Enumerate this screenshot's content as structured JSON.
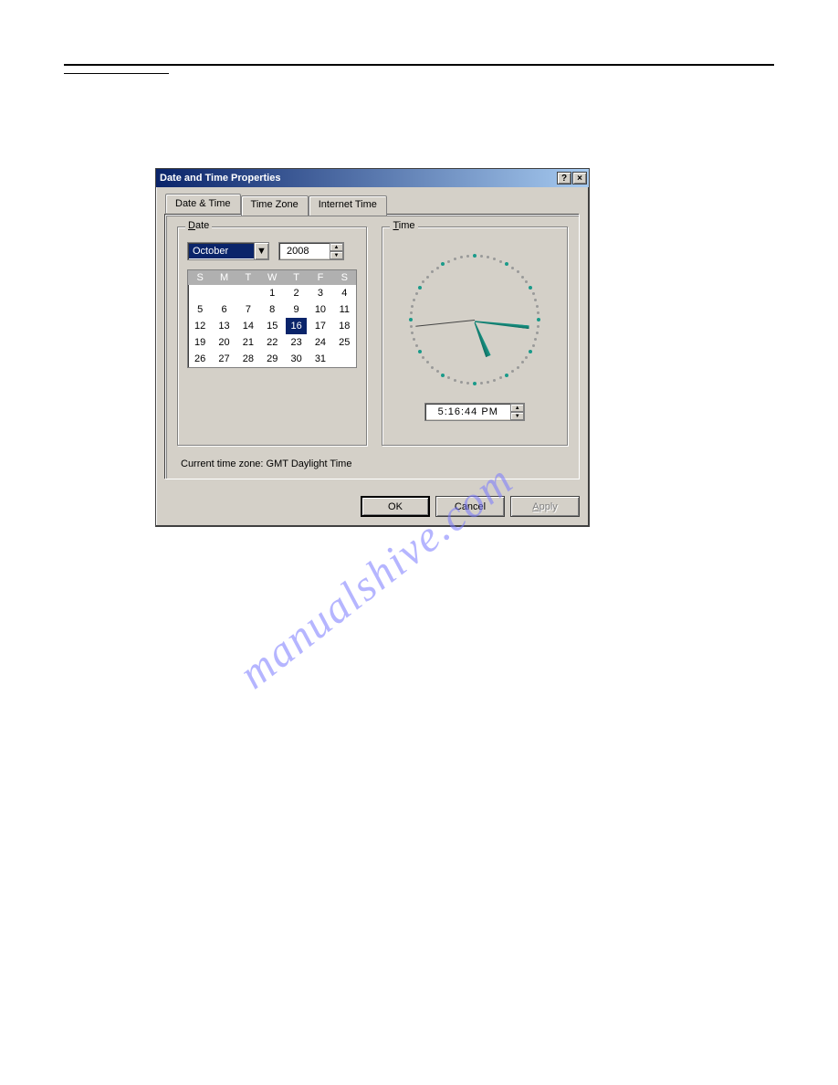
{
  "window": {
    "title": "Date and Time Properties",
    "help_label": "?",
    "close_label": "×"
  },
  "tabs": {
    "date_time": "Date & Time",
    "time_zone": "Time Zone",
    "internet_time": "Internet Time"
  },
  "date": {
    "legend": "Date",
    "month": "October",
    "year": "2008",
    "day_headers": [
      "S",
      "M",
      "T",
      "W",
      "T",
      "F",
      "S"
    ],
    "weeks": [
      [
        "",
        "",
        "",
        "1",
        "2",
        "3",
        "4"
      ],
      [
        "5",
        "6",
        "7",
        "8",
        "9",
        "10",
        "11"
      ],
      [
        "12",
        "13",
        "14",
        "15",
        "16",
        "17",
        "18"
      ],
      [
        "19",
        "20",
        "21",
        "22",
        "23",
        "24",
        "25"
      ],
      [
        "26",
        "27",
        "28",
        "29",
        "30",
        "31",
        ""
      ]
    ],
    "selected_day": "16"
  },
  "time": {
    "legend": "Time",
    "value": "5:16:44 PM"
  },
  "timezone_label": "Current time zone:  GMT Daylight Time",
  "buttons": {
    "ok": "OK",
    "cancel": "Cancel",
    "apply": "Apply"
  },
  "watermark": "manualshive.com"
}
